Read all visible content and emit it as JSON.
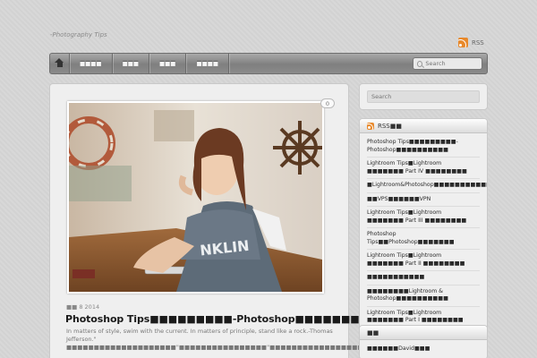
{
  "header": {
    "tagline": "-Photography Tips",
    "rss_label": "RSS"
  },
  "nav": {
    "items": [
      "■■■■",
      "■■■",
      "■■■",
      "■■■■"
    ],
    "search_placeholder": "Search"
  },
  "post": {
    "comment_count": "0",
    "date": "■■ 8 2014",
    "title": "Photoshop Tips■■■■■■■■■-Photoshop■■■■■■■■■■",
    "excerpt": "In matters of style, swim with the current. In matters of principle, stand like a rock.-Thomas Jefferson.\" ■■■■■■■■■■■■■■■■■■■■\"■■■■■■■■■■■■■■■■\"■■■■■■■■■■■■■■■■■■■■■■■■■■■"
  },
  "sidebar": {
    "search_placeholder": "Search",
    "rss_widget": {
      "title": "RSS■■",
      "items": [
        "Photoshop Tips■■■■■■■■■-Photoshop■■■■■■■■■■",
        "Lightroom Tips■Lightroom ■■■■■■■ Part IV ■■■■■■■■",
        "■Lightroom&Photoshop■■■■■■■■■■■■■■■",
        "■■VPS■■■■■■VPN",
        "Lightroom Tips■Lightroom ■■■■■■■ Part III ■■■■■■■■",
        "Photoshop Tips■■Photoshop■■■■■■■",
        "Lightroom Tips■Lightroom ■■■■■■■ Part II ■■■■■■■■",
        "■■■■■■■■■■■",
        "■■■■■■■■Lightroom & Photoshop■■■■■■■■■■",
        "Lightroom Tips■Lightroom ■■■■■■■ Part I ■■■■■■■■"
      ]
    },
    "second_widget": {
      "title": "■■",
      "items": [
        "■■■■■■David■■■"
      ]
    }
  },
  "colors": {
    "rss_orange": "#e8892b",
    "nav_gray": "#8b8b8b",
    "background": "#d6d6d6"
  }
}
